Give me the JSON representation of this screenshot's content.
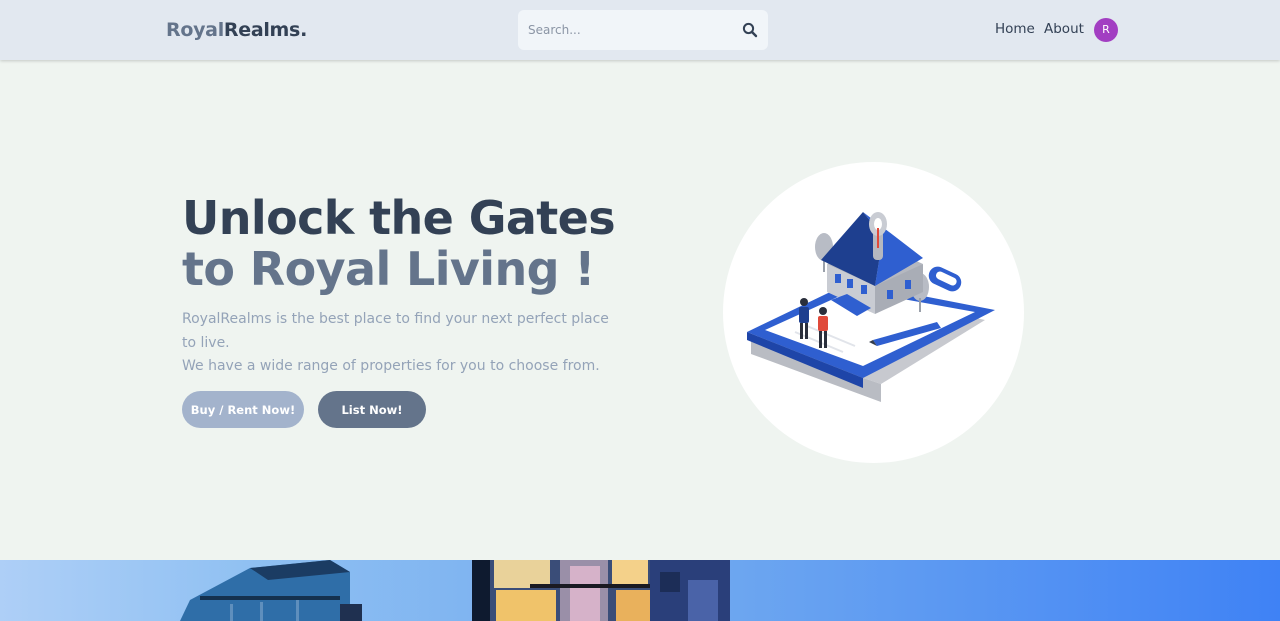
{
  "header": {
    "logo_part1": "Royal",
    "logo_part2": "Realms.",
    "search_placeholder": "Search...",
    "search_icon": "search-icon",
    "nav_home": "Home",
    "nav_about": "About",
    "avatar_initial": "R"
  },
  "hero": {
    "title_line1": "Unlock the Gates",
    "title_line2": "to Royal Living !",
    "description_line1": "RoyalRealms is the best place to find your next perfect place to live.",
    "description_line2": "We have a wide range of properties for you to choose from.",
    "buy_button": "Buy / Rent Now!",
    "list_button": "List Now!"
  },
  "colors": {
    "header_bg": "#e2e8f0",
    "page_bg": "#eff4f0",
    "dark_slate": "#334155",
    "slate": "#64748b",
    "muted": "#94a3b8",
    "avatar": "#a23ec2",
    "accent_blue": "#2f5fd0"
  }
}
